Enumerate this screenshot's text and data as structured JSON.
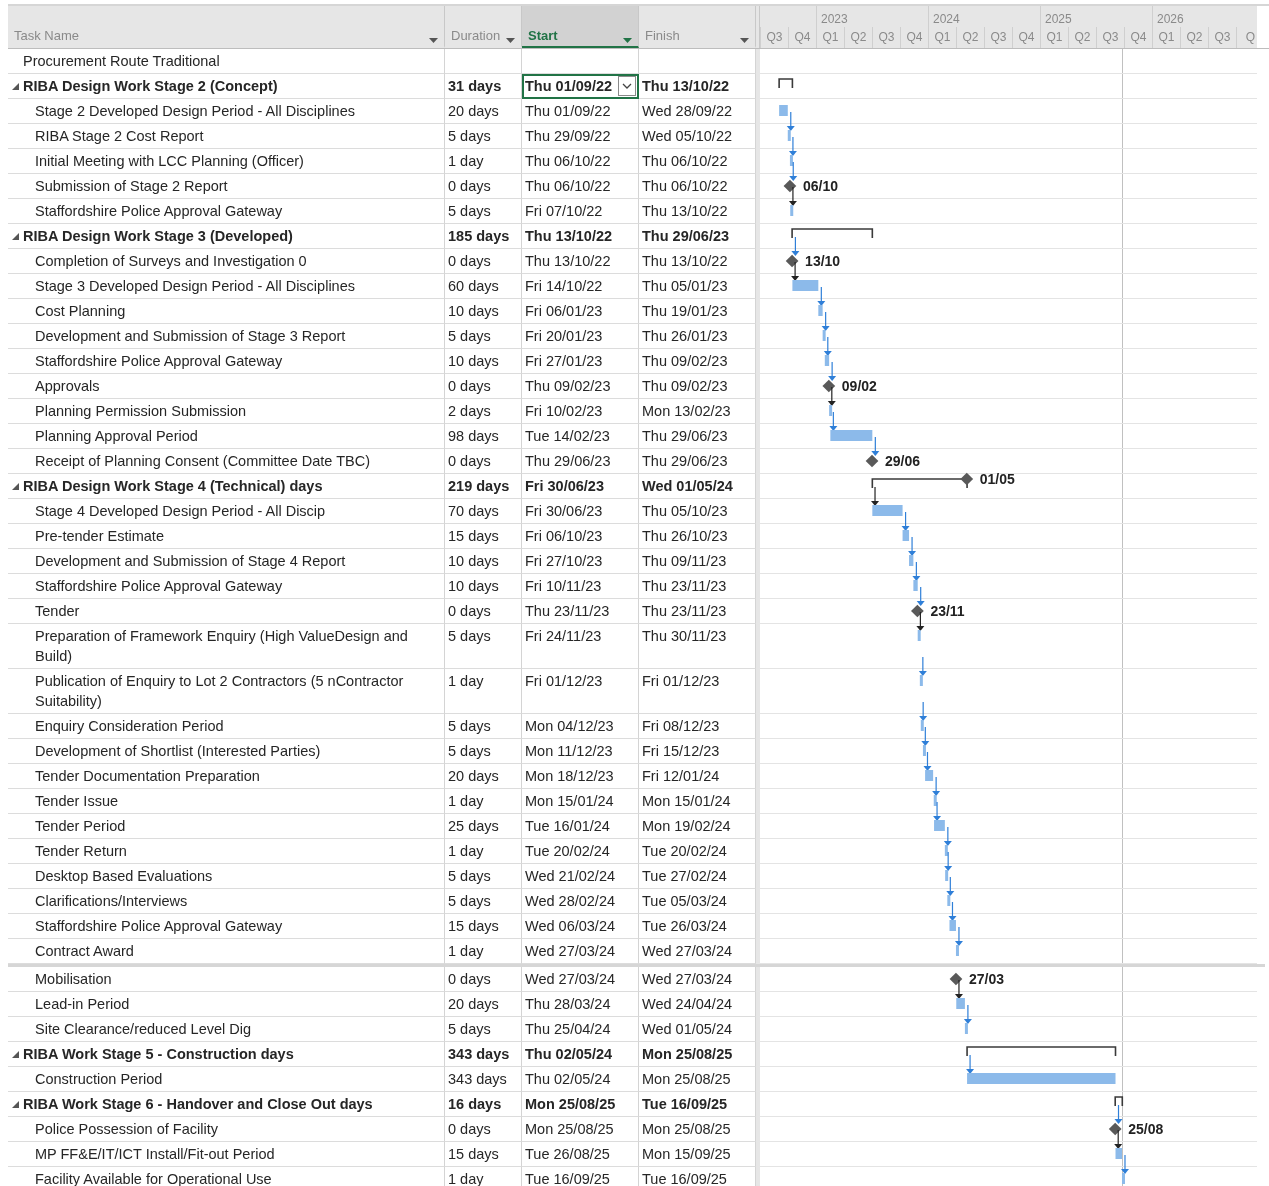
{
  "columns": [
    {
      "label": "Task Name",
      "selected": false
    },
    {
      "label": "Duration",
      "selected": false
    },
    {
      "label": "Start",
      "selected": true
    },
    {
      "label": "Finish",
      "selected": false
    }
  ],
  "timescale": {
    "years": [
      "2023",
      "2024",
      "2025",
      "2026"
    ],
    "quarters": [
      "Q3",
      "Q4",
      "Q1",
      "Q2",
      "Q3",
      "Q4",
      "Q1",
      "Q2",
      "Q3",
      "Q4",
      "Q1",
      "Q2",
      "Q3",
      "Q4",
      "Q1",
      "Q2",
      "Q3",
      "Q"
    ]
  },
  "panes": [
    {
      "rows": [
        {
          "kind": "task",
          "name": "Procurement Route Traditional",
          "selected": false
        },
        {
          "kind": "summary",
          "name": "RIBA Design Work Stage 2 (Concept)",
          "duration": "31 days",
          "start": "Thu 01/09/22",
          "finish": "Thu 13/10/22",
          "selected": true,
          "children": [
            {
              "kind": "task",
              "name": "Stage 2 Developed Design Period - All Disciplines",
              "duration": "20 days",
              "start": "Thu 01/09/22",
              "finish": "Wed 28/09/22",
              "selected": false
            },
            {
              "kind": "task",
              "name": "RIBA Stage 2 Cost Report",
              "duration": "5 days",
              "start": "Thu 29/09/22",
              "finish": "Wed 05/10/22",
              "selected": false
            },
            {
              "kind": "task",
              "name": "Initial Meeting with LCC Planning (Officer)",
              "duration": "1 day",
              "start": "Thu 06/10/22",
              "finish": "Thu 06/10/22",
              "selected": false
            },
            {
              "kind": "milestone",
              "name": "Submission of Stage 2 Report",
              "duration": "0 days",
              "start": "Thu 06/10/22",
              "finish": "Thu 06/10/22",
              "selected": false,
              "gantt_label": "06/10"
            },
            {
              "kind": "task",
              "name": "Staffordshire Police Approval Gateway",
              "duration": "5 days",
              "start": "Fri 07/10/22",
              "finish": "Thu 13/10/22",
              "selected": false
            }
          ]
        },
        {
          "kind": "summary",
          "name": "RIBA Design Work Stage 3 (Developed)",
          "duration": "185 days",
          "start": "Thu 13/10/22",
          "finish": "Thu 29/06/23",
          "selected": false,
          "children": [
            {
              "kind": "milestone",
              "name": "Completion of Surveys and Investigation 0",
              "duration": "0 days",
              "start": "Thu 13/10/22",
              "finish": "Thu 13/10/22",
              "selected": false,
              "gantt_label": "13/10"
            },
            {
              "kind": "task",
              "name": "Stage 3 Developed Design Period - All Disciplines",
              "duration": "60 days",
              "start": "Fri 14/10/22",
              "finish": "Thu 05/01/23",
              "selected": false
            },
            {
              "kind": "task",
              "name": "Cost Planning",
              "duration": "10 days",
              "start": "Fri 06/01/23",
              "finish": "Thu 19/01/23",
              "selected": false
            },
            {
              "kind": "task",
              "name": "Development and Submission of Stage 3 Report",
              "duration": "5 days",
              "start": "Fri 20/01/23",
              "finish": "Thu 26/01/23",
              "selected": false
            },
            {
              "kind": "task",
              "name": "Staffordshire Police Approval Gateway",
              "duration": "10 days",
              "start": "Fri 27/01/23",
              "finish": "Thu 09/02/23",
              "selected": false
            },
            {
              "kind": "milestone",
              "name": "Approvals",
              "duration": "0 days",
              "start": "Thu 09/02/23",
              "finish": "Thu 09/02/23",
              "selected": false,
              "gantt_label": "09/02"
            },
            {
              "kind": "task",
              "name": "Planning Permission Submission",
              "duration": "2 days",
              "start": "Fri 10/02/23",
              "finish": "Mon 13/02/23",
              "selected": false
            },
            {
              "kind": "task",
              "name": "Planning Approval Period",
              "duration": "98 days",
              "start": "Tue 14/02/23",
              "finish": "Thu 29/06/23",
              "selected": false
            },
            {
              "kind": "milestone",
              "name": "Receipt of Planning Consent (Committee Date TBC)",
              "duration": "0 days",
              "start": "Thu 29/06/23",
              "finish": "Thu 29/06/23",
              "selected": false,
              "gantt_label": "29/06"
            }
          ]
        },
        {
          "kind": "summary",
          "name": "RIBA Design Work Stage 4 (Technical) days",
          "duration": "219 days",
          "start": "Fri 30/06/23",
          "finish": "Wed 01/05/24",
          "selected": false,
          "gantt_label": "01/05",
          "children": [
            {
              "kind": "task",
              "name": "Stage 4 Developed Design Period - All Discip",
              "duration": "70 days",
              "start": "Fri 30/06/23",
              "finish": "Thu 05/10/23",
              "selected": false
            },
            {
              "kind": "task",
              "name": "Pre-tender Estimate",
              "duration": "15 days",
              "start": "Fri 06/10/23",
              "finish": "Thu 26/10/23",
              "selected": false
            },
            {
              "kind": "task",
              "name": "Development and Submission of Stage 4 Report",
              "duration": "10 days",
              "start": "Fri 27/10/23",
              "finish": "Thu 09/11/23",
              "selected": false
            },
            {
              "kind": "task",
              "name": "Staffordshire Police Approval Gateway",
              "duration": "10 days",
              "start": "Fri 10/11/23",
              "finish": "Thu 23/11/23",
              "selected": false
            },
            {
              "kind": "milestone",
              "name": "Tender",
              "duration": "0 days",
              "start": "Thu 23/11/23",
              "finish": "Thu 23/11/23",
              "selected": false,
              "gantt_label": "23/11"
            },
            {
              "kind": "task",
              "name": "Preparation of Framework Enquiry (High ValueDesign and Build)",
              "duration": "5 days",
              "start": "Fri 24/11/23",
              "finish": "Thu 30/11/23",
              "selected": false
            },
            {
              "kind": "task",
              "name": "Publication of Enquiry to Lot 2 Contractors (5 nContractor Suitability)",
              "duration": "1 day",
              "start": "Fri 01/12/23",
              "finish": "Fri 01/12/23",
              "selected": false
            },
            {
              "kind": "task",
              "name": "Enquiry Consideration Period",
              "duration": "5 days",
              "start": "Mon 04/12/23",
              "finish": "Fri 08/12/23",
              "selected": false
            },
            {
              "kind": "task",
              "name": "Development of Shortlist (Interested Parties)",
              "duration": "5 days",
              "start": "Mon 11/12/23",
              "finish": "Fri 15/12/23",
              "selected": false
            },
            {
              "kind": "task",
              "name": "Tender Documentation Preparation",
              "duration": "20 days",
              "start": "Mon 18/12/23",
              "finish": "Fri 12/01/24",
              "selected": false
            },
            {
              "kind": "task",
              "name": "Tender Issue",
              "duration": "1 day",
              "start": "Mon 15/01/24",
              "finish": "Mon 15/01/24",
              "selected": false
            },
            {
              "kind": "task",
              "name": "Tender Period",
              "duration": "25 days",
              "start": "Tue 16/01/24",
              "finish": "Mon 19/02/24",
              "selected": false
            },
            {
              "kind": "task",
              "name": "Tender Return",
              "duration": "1 day",
              "start": "Tue 20/02/24",
              "finish": "Tue 20/02/24",
              "selected": false
            },
            {
              "kind": "task",
              "name": "Desktop Based Evaluations",
              "duration": "5 days",
              "start": "Wed 21/02/24",
              "finish": "Tue 27/02/24",
              "selected": false
            },
            {
              "kind": "task",
              "name": "Clarifications/Interviews",
              "duration": "5 days",
              "start": "Wed 28/02/24",
              "finish": "Tue 05/03/24",
              "selected": false
            },
            {
              "kind": "task",
              "name": "Staffordshire Police Approval Gateway",
              "duration": "15 days",
              "start": "Wed 06/03/24",
              "finish": "Tue 26/03/24",
              "selected": false
            },
            {
              "kind": "task",
              "name": "Contract Award",
              "duration": "1 day",
              "start": "Wed 27/03/24",
              "finish": "Wed 27/03/24",
              "selected": false
            }
          ]
        }
      ]
    },
    {
      "rows": [
        {
          "kind": "continuation",
          "children": [
            {
              "kind": "milestone",
              "name": "Mobilisation",
              "duration": "0 days",
              "start": "Wed 27/03/24",
              "finish": "Wed 27/03/24",
              "selected": false,
              "gantt_label": "27/03"
            },
            {
              "kind": "task",
              "name": "Lead-in Period",
              "duration": "20 days",
              "start": "Thu 28/03/24",
              "finish": "Wed 24/04/24",
              "selected": false
            },
            {
              "kind": "task",
              "name": "Site Clearance/reduced Level Dig",
              "duration": "5 days",
              "start": "Thu 25/04/24",
              "finish": "Wed 01/05/24",
              "selected": false
            }
          ]
        },
        {
          "kind": "summary",
          "name": "RIBA Work Stage 5 - Construction days",
          "duration": "343 days",
          "start": "Thu 02/05/24",
          "finish": "Mon 25/08/25",
          "selected": false,
          "children": [
            {
              "kind": "task",
              "name": "Construction Period",
              "duration": "343 days",
              "start": "Thu 02/05/24",
              "finish": "Mon 25/08/25",
              "selected": false
            }
          ]
        },
        {
          "kind": "summary",
          "name": "RIBA Work Stage 6 - Handover and Close Out days",
          "duration": "16 days",
          "start": "Mon 25/08/25",
          "finish": "Tue 16/09/25",
          "selected": false,
          "children": [
            {
              "kind": "milestone",
              "name": "Police Possession of Facility",
              "duration": "0 days",
              "start": "Mon 25/08/25",
              "finish": "Mon 25/08/25",
              "selected": false,
              "gantt_label": "25/08"
            },
            {
              "kind": "task",
              "name": "MP FF&E/IT/ICT Install/Fit-out Period",
              "duration": "15 days",
              "start": "Tue 26/08/25",
              "finish": "Mon 15/09/25",
              "selected": false
            },
            {
              "kind": "task",
              "name": "Facility Available for Operational Use",
              "duration": "1 day",
              "start": "Tue 16/09/25",
              "finish": "Tue 16/09/25",
              "selected": false
            }
          ]
        }
      ]
    }
  ]
}
